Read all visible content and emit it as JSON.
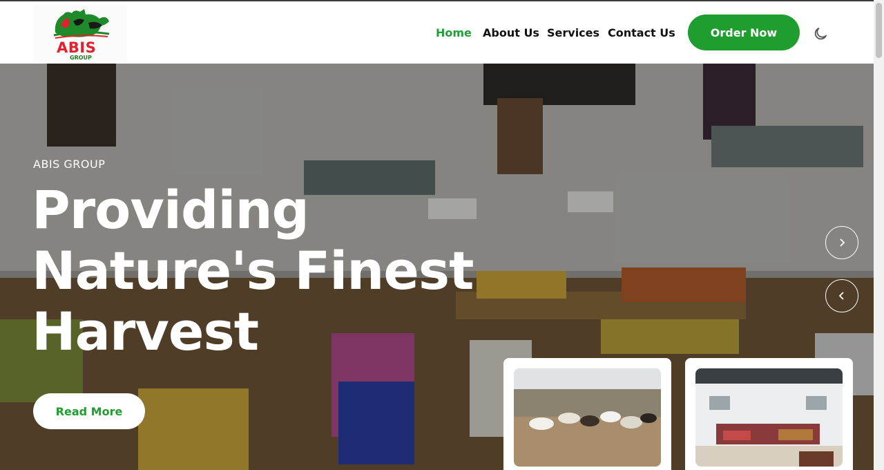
{
  "brand": {
    "logo_text": "ABIS",
    "logo_sub": "GROUP"
  },
  "nav": {
    "items": [
      {
        "label": "Home",
        "active": true
      },
      {
        "label": "About Us",
        "active": false
      },
      {
        "label": "Services",
        "active": false
      },
      {
        "label": "Contact Us",
        "active": false
      }
    ],
    "order_label": "Order Now",
    "theme_icon": "moon-icon"
  },
  "hero": {
    "kicker": "ABIS GROUP",
    "headline_lines": [
      "Providing",
      "Nature's Finest",
      "Harvest"
    ],
    "read_more_label": "Read More",
    "next_icon": "chevron-right-icon",
    "prev_icon": "chevron-left-icon",
    "thumbnails": [
      {
        "icon": "goats-photo"
      },
      {
        "icon": "market-interior-photo"
      }
    ]
  },
  "colors": {
    "accent": "#1f9d2f",
    "active_link": "#21a038",
    "logo_red": "#e3202c"
  }
}
